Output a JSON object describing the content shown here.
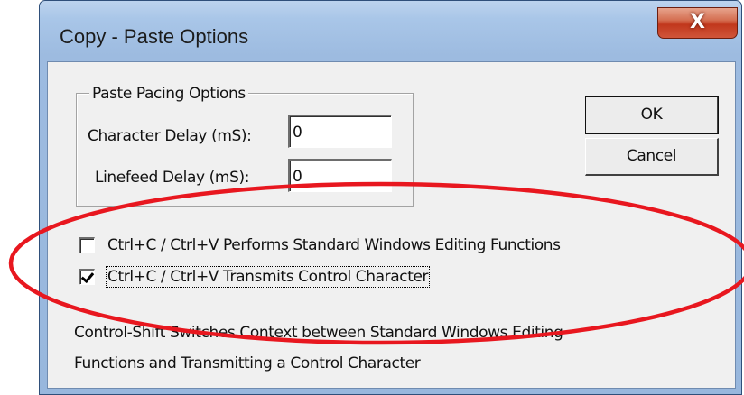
{
  "window": {
    "title": "Copy - Paste Options",
    "close_glyph": "X"
  },
  "pacing": {
    "group_label": "Paste Pacing Options",
    "char_delay_label": "Character Delay (mS):",
    "char_delay_value": "0",
    "linefeed_delay_label": "Linefeed Delay  (mS):",
    "linefeed_delay_value": "0"
  },
  "buttons": {
    "ok_label": "OK",
    "cancel_label": "Cancel"
  },
  "options": {
    "standard_editing_label": "Ctrl+C / Ctrl+V Performs Standard Windows Editing Functions",
    "standard_editing_checked": false,
    "transmit_control_label": "Ctrl+C / Ctrl+V Transmits Control Character",
    "transmit_control_checked": true
  },
  "description": {
    "line1": "Control-Shift Switches Context between Standard Windows Editing",
    "line2": "Functions and Transmitting a Control Character"
  },
  "annotation": {
    "color": "#e8171f"
  }
}
